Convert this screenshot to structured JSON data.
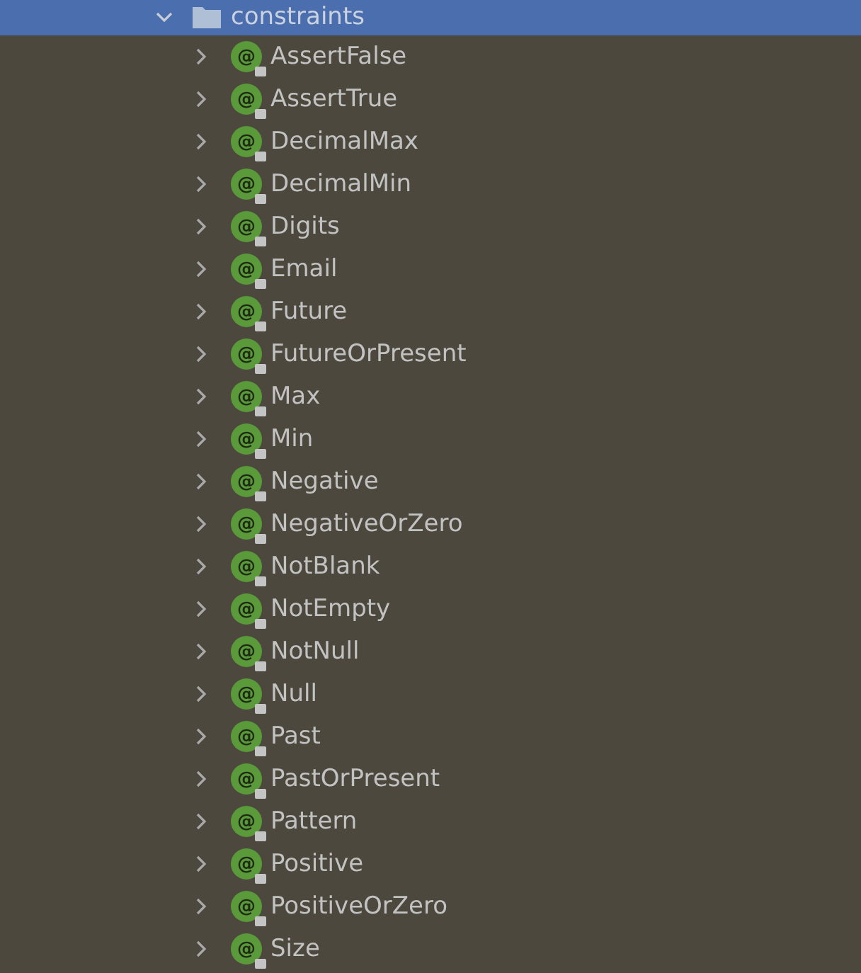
{
  "folder": {
    "label": "constraints",
    "expanded": true,
    "selected": true
  },
  "items": [
    {
      "label": "AssertFalse",
      "badge": "@",
      "expanded": false
    },
    {
      "label": "AssertTrue",
      "badge": "@",
      "expanded": false
    },
    {
      "label": "DecimalMax",
      "badge": "@",
      "expanded": false
    },
    {
      "label": "DecimalMin",
      "badge": "@",
      "expanded": false
    },
    {
      "label": "Digits",
      "badge": "@",
      "expanded": false
    },
    {
      "label": "Email",
      "badge": "@",
      "expanded": false
    },
    {
      "label": "Future",
      "badge": "@",
      "expanded": false
    },
    {
      "label": "FutureOrPresent",
      "badge": "@",
      "expanded": false
    },
    {
      "label": "Max",
      "badge": "@",
      "expanded": false
    },
    {
      "label": "Min",
      "badge": "@",
      "expanded": false
    },
    {
      "label": "Negative",
      "badge": "@",
      "expanded": false
    },
    {
      "label": "NegativeOrZero",
      "badge": "@",
      "expanded": false
    },
    {
      "label": "NotBlank",
      "badge": "@",
      "expanded": false
    },
    {
      "label": "NotEmpty",
      "badge": "@",
      "expanded": false
    },
    {
      "label": "NotNull",
      "badge": "@",
      "expanded": false
    },
    {
      "label": "Null",
      "badge": "@",
      "expanded": false
    },
    {
      "label": "Past",
      "badge": "@",
      "expanded": false
    },
    {
      "label": "PastOrPresent",
      "badge": "@",
      "expanded": false
    },
    {
      "label": "Pattern",
      "badge": "@",
      "expanded": false
    },
    {
      "label": "Positive",
      "badge": "@",
      "expanded": false
    },
    {
      "label": "PositiveOrZero",
      "badge": "@",
      "expanded": false
    },
    {
      "label": "Size",
      "badge": "@",
      "expanded": false
    }
  ]
}
